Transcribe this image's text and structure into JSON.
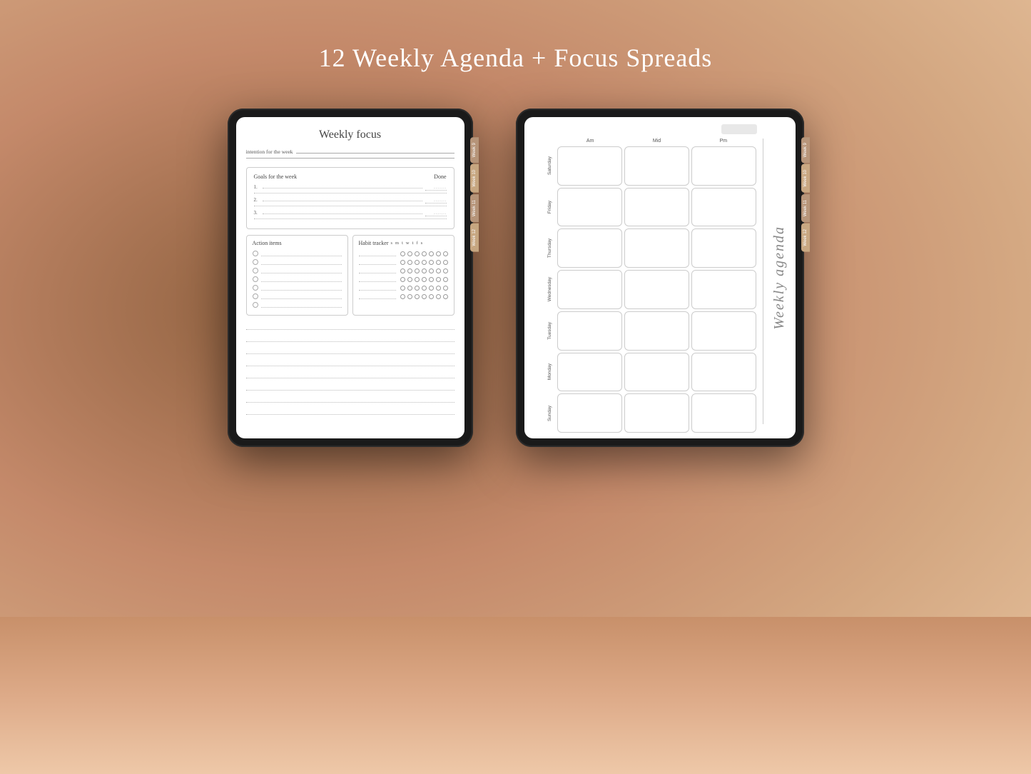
{
  "page": {
    "title": "12 Weekly Agenda + Focus Spreads"
  },
  "left_tablet": {
    "focus_page": {
      "title": "Weekly focus",
      "intention_label": "intention for the week",
      "goals_section": {
        "header_left": "Goals for the week",
        "header_right": "Done",
        "goals": [
          {
            "num": "1."
          },
          {
            "num": "2."
          },
          {
            "num": "3."
          }
        ]
      },
      "action_items": {
        "title": "Action items",
        "rows": 7
      },
      "habit_tracker": {
        "title": "Habit tracker",
        "days": [
          "s",
          "m",
          "t",
          "w",
          "t",
          "f",
          "s"
        ],
        "rows": 6
      }
    },
    "tabs": [
      "Week 9",
      "Week 10",
      "Week 11",
      "Week 12"
    ]
  },
  "right_tablet": {
    "agenda_page": {
      "title": "Weekly agenda",
      "col_headers": [
        "Am",
        "Mid",
        "Pm"
      ],
      "days": [
        "Saturday",
        "Friday",
        "Thursday",
        "Wednesday",
        "Tuesday",
        "Monday",
        "Sunday"
      ]
    },
    "tabs": [
      "Week 9",
      "Week 10",
      "Week 11",
      "Week 12"
    ]
  }
}
